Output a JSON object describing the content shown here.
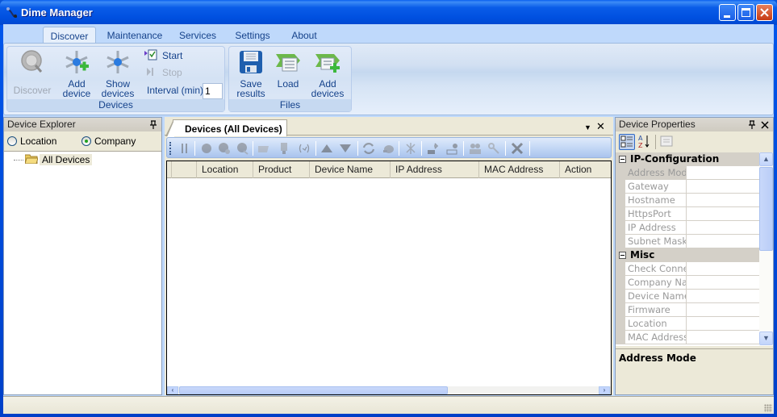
{
  "window": {
    "title": "Dime Manager",
    "controls": [
      "minimize",
      "maximize",
      "close"
    ]
  },
  "ribbon": {
    "tabs": [
      {
        "label": "Discover",
        "active": true
      },
      {
        "label": "Maintenance",
        "active": false
      },
      {
        "label": "Services",
        "active": false
      },
      {
        "label": "Settings",
        "active": false
      },
      {
        "label": "About",
        "active": false
      }
    ],
    "groups": {
      "devices": {
        "label": "Devices",
        "discover": {
          "label": "Discover",
          "icon": "magnifier-icon",
          "enabled": false
        },
        "add_device": {
          "label1": "Add",
          "label2": "device",
          "icon": "network-add-icon"
        },
        "show_devices": {
          "label1": "Show",
          "label2": "devices",
          "icon": "network-icon"
        },
        "start": {
          "label": "Start",
          "icon": "start-icon",
          "enabled": true
        },
        "stop": {
          "label": "Stop",
          "icon": "stop-icon",
          "enabled": false
        },
        "interval": {
          "label": "Interval (min):",
          "value": "1"
        }
      },
      "files": {
        "label": "Files",
        "save_results": {
          "label1": "Save",
          "label2": "results",
          "icon": "floppy-disk-icon"
        },
        "load": {
          "label": "Load",
          "icon": "load-list-icon"
        },
        "add_devices": {
          "label1": "Add",
          "label2": "devices",
          "icon": "add-list-icon"
        }
      }
    }
  },
  "device_explorer": {
    "title": "Device Explorer",
    "pin_icon": "pin-icon",
    "radios": [
      {
        "label": "Location",
        "checked": false
      },
      {
        "label": "Company",
        "checked": true
      }
    ],
    "tree": [
      {
        "label": "All Devices",
        "icon": "folder-icon"
      }
    ]
  },
  "devices_doc": {
    "tab_label": "Devices (All Devices)",
    "toolbar_icons": [
      "properties-icon",
      "connect-icon",
      "connect-web-icon",
      "disconnect-icon",
      "open-folder-icon",
      "device-config-icon",
      "ping-icon",
      "move-up-icon",
      "move-down-icon",
      "refresh-icon",
      "firmware-icon",
      "tools-icon",
      "upload-icon",
      "download-icon",
      "users-icon",
      "key-icon",
      "delete-icon"
    ],
    "columns": [
      "",
      "Location",
      "Product",
      "Device Name",
      "IP Address",
      "MAC Address",
      "Action"
    ],
    "rows": []
  },
  "device_properties": {
    "title": "Device Properties",
    "categories": [
      {
        "name": "IP-Configuration",
        "items": [
          "Address Mode",
          "Gateway",
          "Hostname",
          "HttpsPort",
          "IP Address",
          "Subnet Mask"
        ]
      },
      {
        "name": "Misc",
        "items": [
          "Check Connect",
          "Company Name",
          "Device Name",
          "Firmware",
          "Location",
          "MAC Address"
        ]
      }
    ],
    "selected": "Address Mode",
    "description_title": "Address Mode"
  }
}
